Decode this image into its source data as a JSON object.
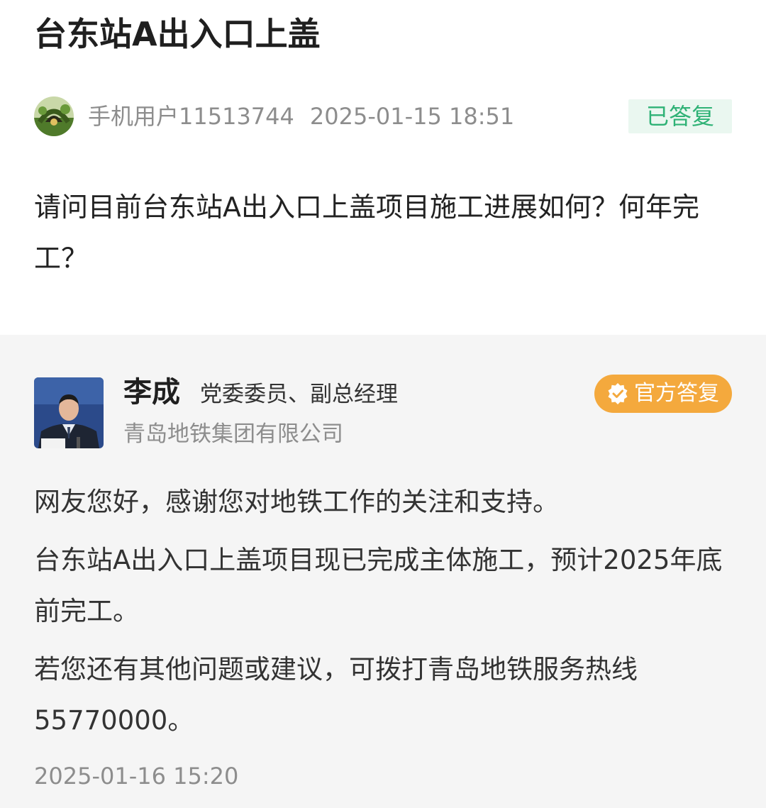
{
  "question": {
    "title": "台东站A出入口上盖",
    "asker": {
      "name": "手机用户11513744",
      "timestamp": "2025-01-15 18:51",
      "avatar_icon": "garden-avatar-icon"
    },
    "status": "已答复",
    "status_color": "#2fb276",
    "body": "请问目前台东站A出入口上盖项目施工进展如何？何年完工？"
  },
  "answer": {
    "responder": {
      "name": "李成",
      "title": "党委委员、副总经理",
      "organization": "青岛地铁集团有限公司",
      "photo_icon": "responder-photo"
    },
    "badge": {
      "label": "官方答复",
      "icon": "verified-check-icon",
      "color": "#f4a93d"
    },
    "paragraphs": [
      "网友您好，感谢您对地铁工作的关注和支持。",
      "台东站A出入口上盖项目现已完成主体施工，预计2025年底前完工。",
      "若您还有其他问题或建议，可拨打青岛地铁服务热线55770000。"
    ],
    "timestamp": "2025-01-16 15:20"
  }
}
